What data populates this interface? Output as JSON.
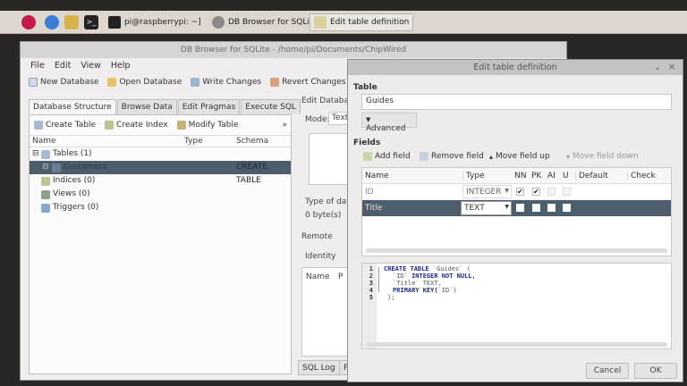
{
  "taskbar": {
    "terminal_task": "pi@raspberrypi: ~]",
    "db_task": "DB Browser for SQLit...",
    "edit_task": "Edit table definition"
  },
  "main_window": {
    "title": "DB Browser for SQLite - /home/pi/Documents/ChipWired",
    "menu": [
      "File",
      "Edit",
      "View",
      "Help"
    ],
    "toolbar": {
      "new_db": "New Database",
      "open_db": "Open Database",
      "write": "Write Changes",
      "revert": "Revert Changes"
    },
    "tabs": [
      "Database Structure",
      "Browse Data",
      "Edit Pragmas",
      "Execute SQL"
    ],
    "subtoolbar": {
      "create_table": "Create Table",
      "create_index": "Create Index",
      "modify_table": "Modify Table",
      "more": "»"
    },
    "tree_headers": {
      "name": "Name",
      "type": "Type",
      "schema": "Schema"
    },
    "tree": [
      {
        "label": "Tables (1)",
        "schema": ""
      },
      {
        "label": "Customers",
        "schema": "CREATE TABLE"
      },
      {
        "label": "Indices (0)",
        "schema": ""
      },
      {
        "label": "Views (0)",
        "schema": ""
      },
      {
        "label": "Triggers (0)",
        "schema": ""
      }
    ],
    "right": {
      "edit_db": "Edit Databa",
      "mode_label": "Mode:",
      "mode_value": "Text",
      "type_of": "Type of data",
      "bytes": "0 byte(s)",
      "remote": "Remote",
      "identity": "Identity",
      "name_hdr": "Name",
      "p_hdr": "P",
      "sql_log": "SQL Log",
      "p_tab": "P"
    }
  },
  "dialog": {
    "title": "Edit table definition",
    "table_label": "Table",
    "table_name": "Guides",
    "advanced": "Advanced",
    "fields_label": "Fields",
    "add_field": "Add field",
    "remove_field": "Remove field",
    "move_up": "Move field up",
    "move_down": "Move field down",
    "columns": [
      "Name",
      "Type",
      "NN",
      "PK",
      "AI",
      "U",
      "Default",
      "Check"
    ],
    "rows": [
      {
        "name": "ID",
        "type": "INTEGER",
        "nn": true,
        "pk": true,
        "ai": false,
        "u": false
      },
      {
        "name": "Title",
        "type": "TEXT",
        "nn": false,
        "pk": false,
        "ai": false,
        "u": false
      }
    ],
    "sql_lines": [
      "1",
      "2",
      "3",
      "4",
      "5"
    ],
    "sql": {
      "l1_kw": "CREATE TABLE",
      "l1_str": " `Guides` (",
      "l2_str": "`ID`",
      "l2_kw": " INTEGER NOT NULL,",
      "l3_str": "`Title` TEXT,",
      "l4_kw": "PRIMARY KEY(",
      "l4_str": "`ID`",
      "l4_end": ")",
      "l5": ");"
    },
    "cancel": "Cancel",
    "ok": "OK"
  },
  "colors": {
    "selection": "#4d5d6c",
    "dialog_bg": "#eeecea",
    "sql_keyword": "#1f2b86"
  }
}
